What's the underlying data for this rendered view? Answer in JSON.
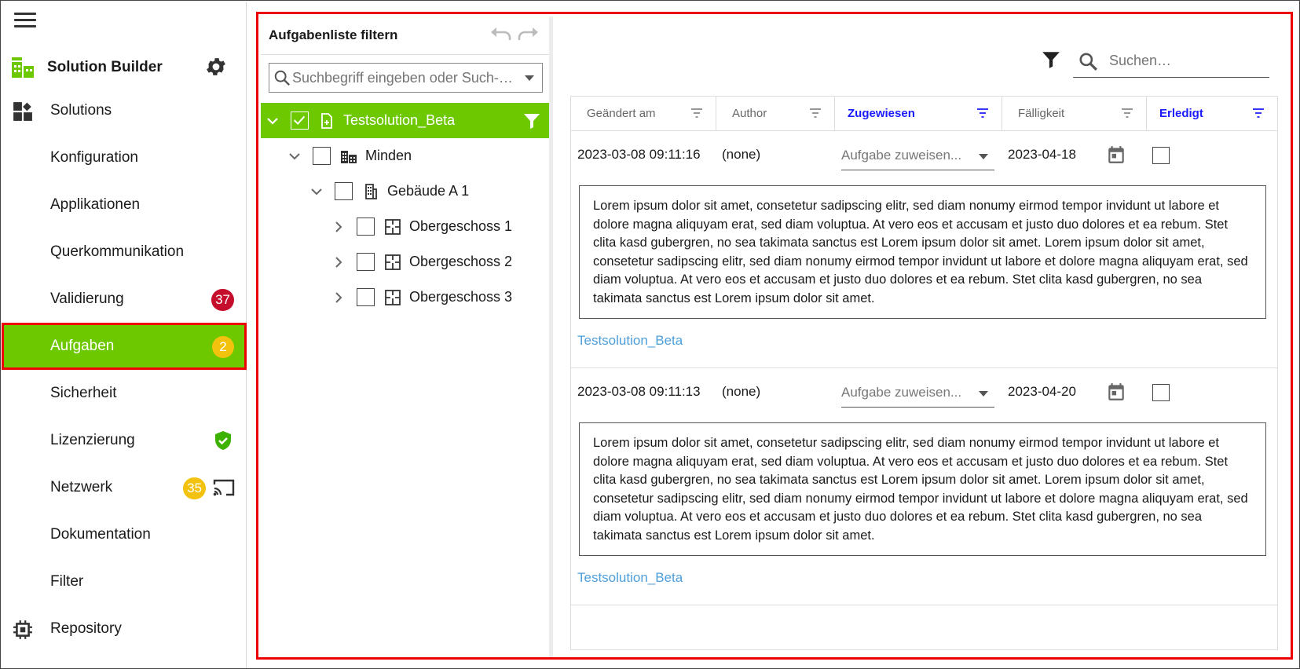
{
  "app": {
    "title": "Solution Builder",
    "accent": "#6ec800",
    "alert": "#e00000"
  },
  "nav": {
    "items": [
      {
        "label": "Solutions"
      },
      {
        "label": "Konfiguration"
      },
      {
        "label": "Applikationen"
      },
      {
        "label": "Querkommunikation"
      },
      {
        "label": "Validierung",
        "badge": "37"
      },
      {
        "label": "Aufgaben",
        "badge": "2"
      },
      {
        "label": "Sicherheit"
      },
      {
        "label": "Lizenzierung"
      },
      {
        "label": "Netzwerk",
        "badge": "35"
      },
      {
        "label": "Dokumentation"
      },
      {
        "label": "Filter"
      },
      {
        "label": "Repository"
      }
    ]
  },
  "filter": {
    "title": "Aufgabenliste filtern",
    "search_placeholder": "Suchbegriff eingeben oder Such-…",
    "tree": [
      {
        "label": "Testsolution_Beta"
      },
      {
        "label": "Minden"
      },
      {
        "label": "Gebäude A 1"
      },
      {
        "label": "Obergeschoss 1"
      },
      {
        "label": "Obergeschoss 2"
      },
      {
        "label": "Obergeschoss 3"
      }
    ]
  },
  "tasks": {
    "search_placeholder": "Suchen…",
    "columns": [
      "Geändert am",
      "Author",
      "Zugewiesen",
      "Fälligkeit",
      "Erledigt"
    ],
    "rows": [
      {
        "changed": "2023-03-08 09:11:16",
        "author": "(none)",
        "assign_placeholder": "Aufgabe zuweisen...",
        "due": "2023-04-18",
        "description": "Lorem ipsum dolor sit amet, consetetur sadipscing elitr, sed diam nonumy eirmod tempor invidunt ut labore et dolore magna aliquyam erat, sed diam voluptua. At vero eos et accusam et justo duo dolores et ea rebum. Stet clita kasd gubergren, no sea takimata sanctus est Lorem ipsum dolor sit amet. Lorem ipsum dolor sit amet, consetetur sadipscing elitr, sed diam nonumy eirmod tempor invidunt ut labore et dolore magna aliquyam erat, sed diam voluptua. At vero eos et accusam et justo duo dolores et ea rebum. Stet clita kasd gubergren, no sea takimata sanctus est Lorem ipsum dolor sit amet.",
        "solution": "Testsolution_Beta"
      },
      {
        "changed": "2023-03-08 09:11:13",
        "author": "(none)",
        "assign_placeholder": "Aufgabe zuweisen...",
        "due": "2023-04-20",
        "description": "Lorem ipsum dolor sit amet, consetetur sadipscing elitr, sed diam nonumy eirmod tempor invidunt ut labore et dolore magna aliquyam erat, sed diam voluptua. At vero eos et accusam et justo duo dolores et ea rebum. Stet clita kasd gubergren, no sea takimata sanctus est Lorem ipsum dolor sit amet. Lorem ipsum dolor sit amet, consetetur sadipscing elitr, sed diam nonumy eirmod tempor invidunt ut labore et dolore magna aliquyam erat, sed diam voluptua. At vero eos et accusam et justo duo dolores et ea rebum. Stet clita kasd gubergren, no sea takimata sanctus est Lorem ipsum dolor sit amet.",
        "solution": "Testsolution_Beta"
      }
    ]
  }
}
